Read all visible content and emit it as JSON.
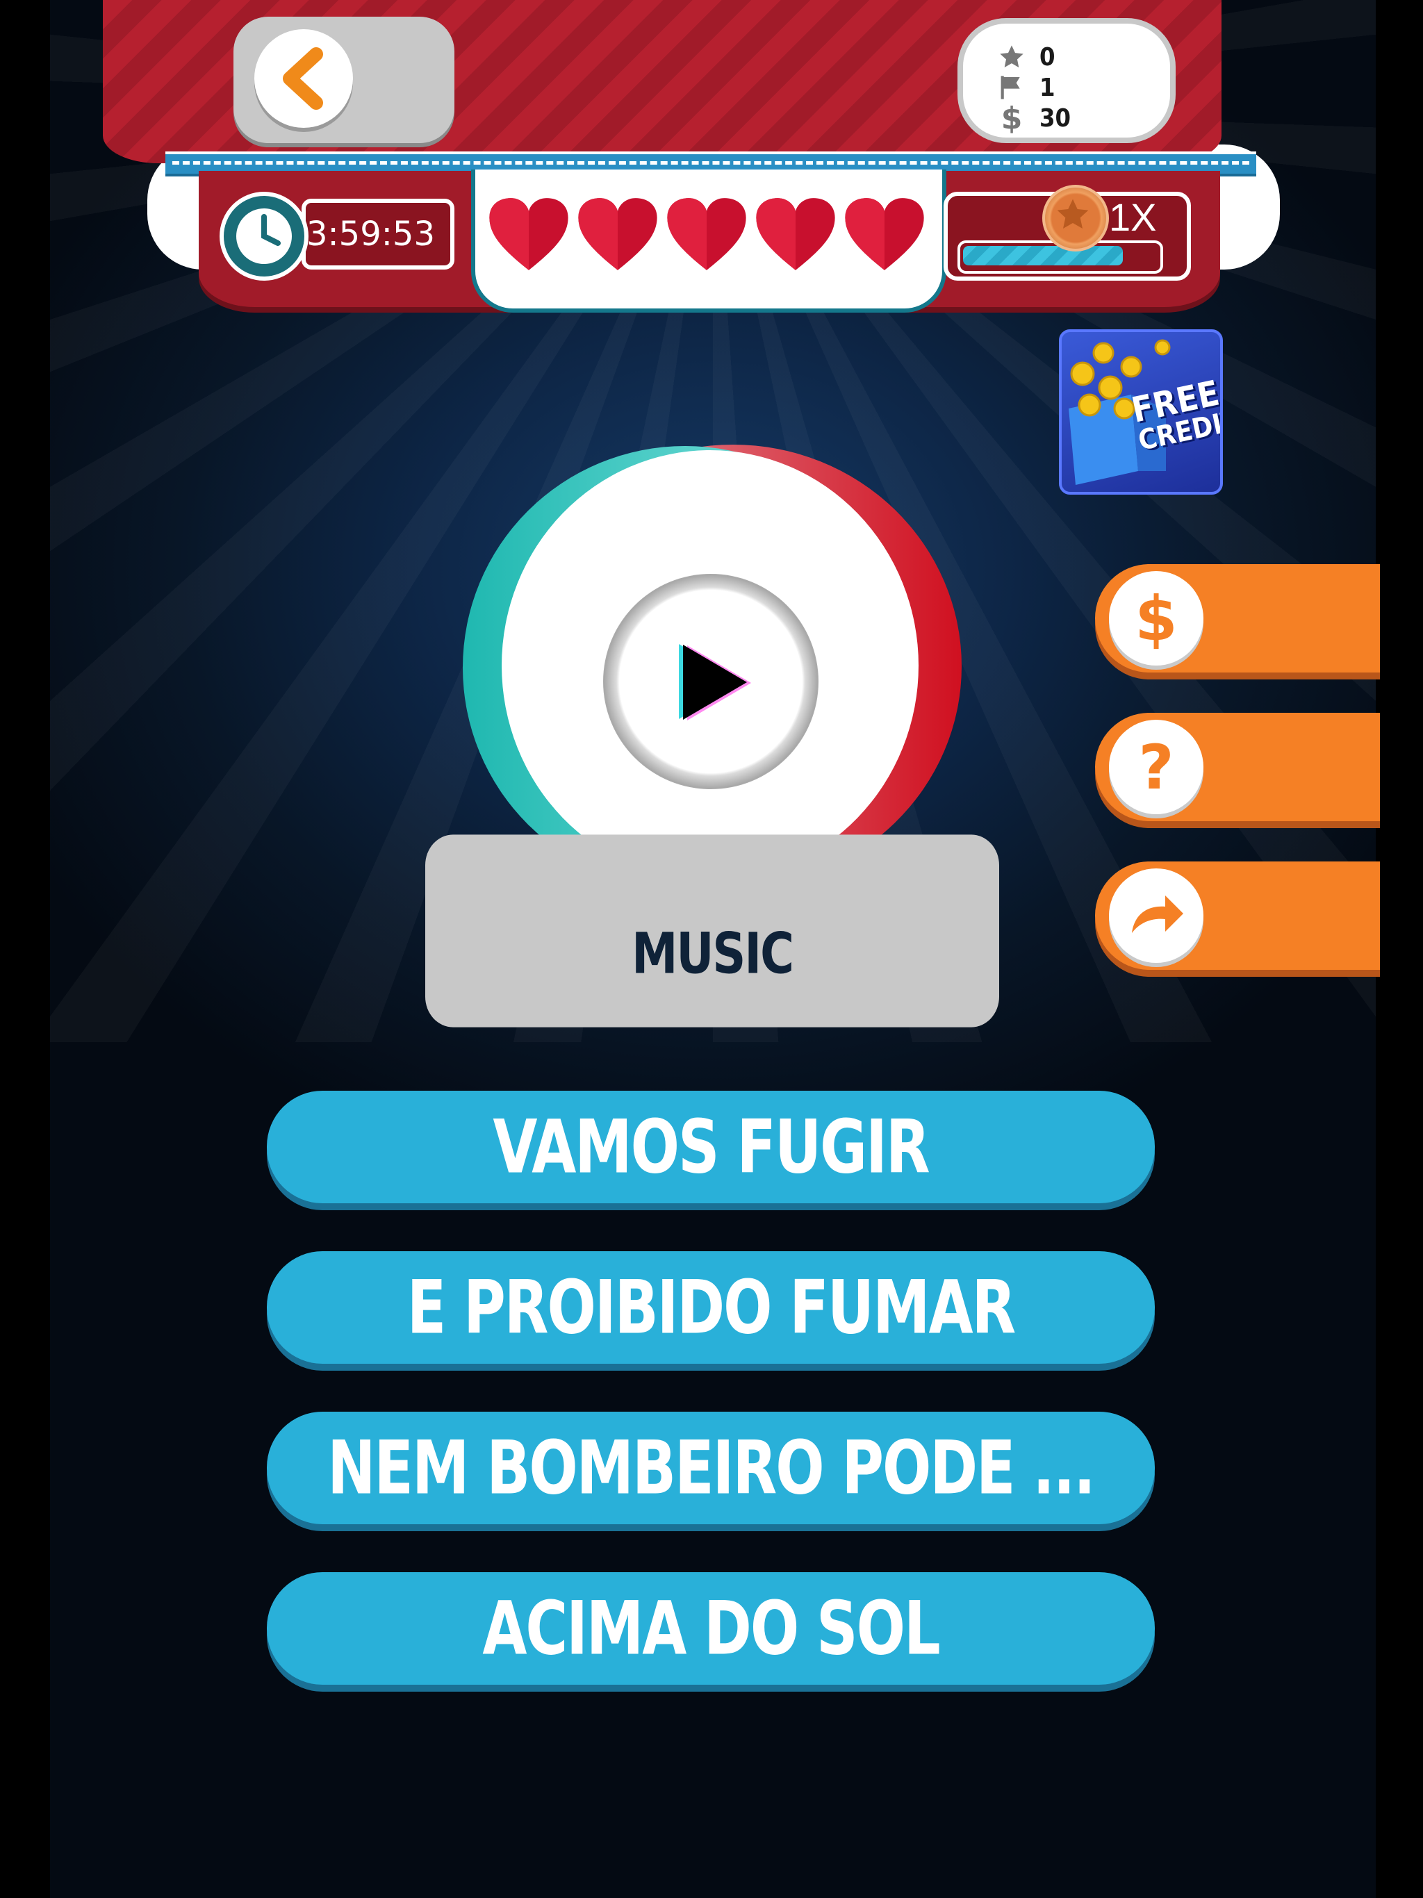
{
  "stats": {
    "stars": "0",
    "flags": "1",
    "money": "30"
  },
  "timer": "3:59:53",
  "lives": 5,
  "multiplier": "1X",
  "xp_progress": 0.82,
  "free_credits": {
    "line1": "FREE",
    "line2": "CREDITS"
  },
  "category": "MUSIC",
  "answers": [
    "VAMOS FUGIR",
    "E PROIBIDO FUMAR",
    "NEM BOMBEIRO PODE ...",
    "ACIMA DO SOL"
  ],
  "lifelines": {
    "coin_symbol": "$",
    "hint_symbol": "?"
  }
}
